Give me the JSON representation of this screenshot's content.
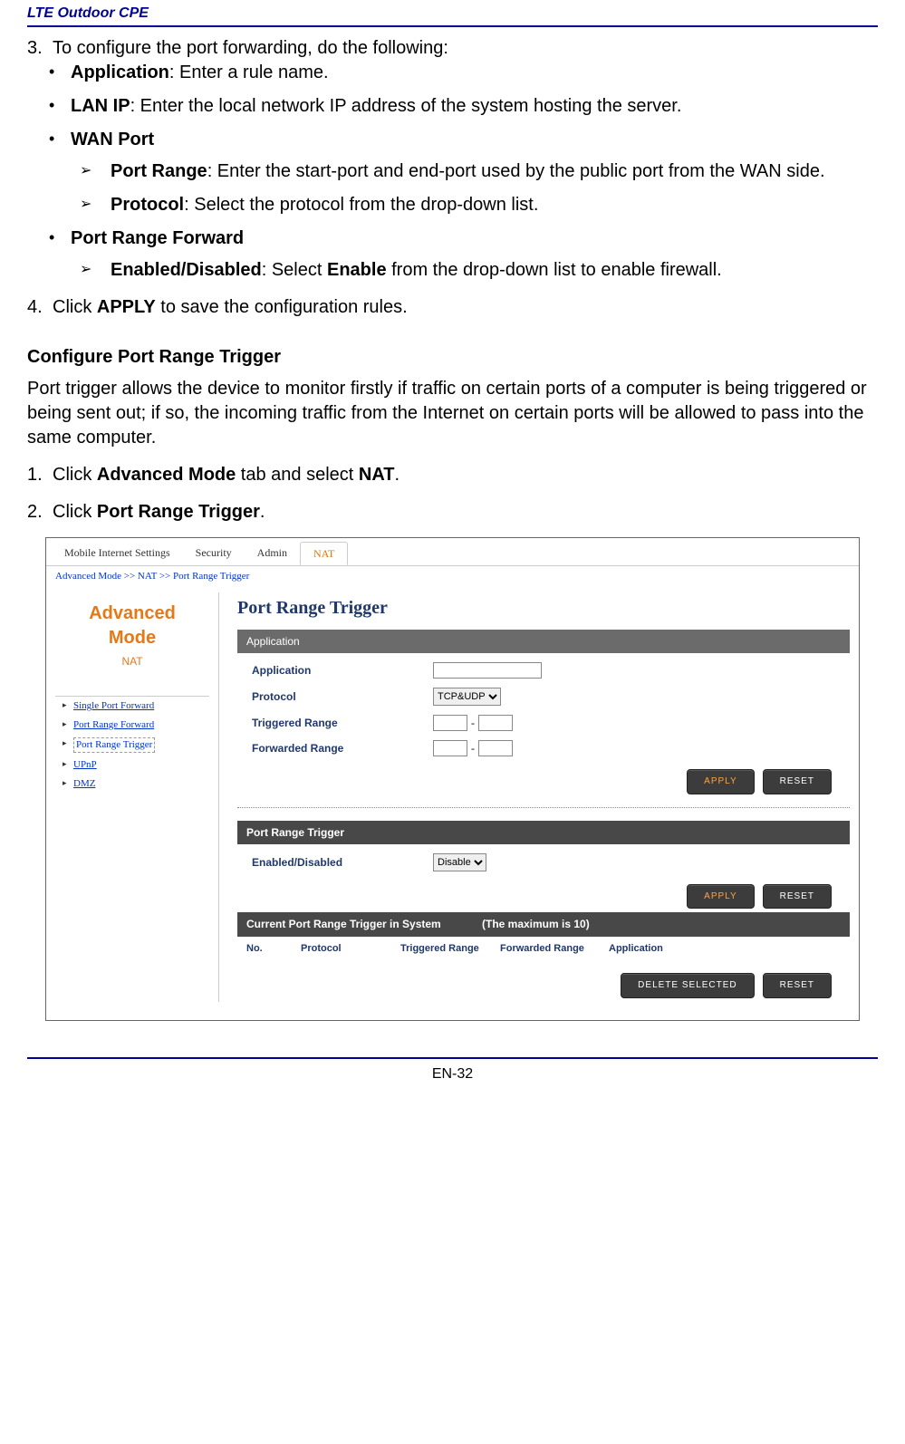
{
  "doc": {
    "header": "LTE Outdoor CPE",
    "page_num": "EN-32",
    "step3_intro": "To configure the port forwarding, do the following:",
    "step3_num": "3.",
    "b_app_t": "Application",
    "b_app_d": ": Enter a rule name.",
    "b_lan_t": "LAN IP",
    "b_lan_d": ": Enter the local network IP address of the system hosting the server.",
    "b_wan_t": "WAN Port",
    "b_pr_t": "Port Range",
    "b_pr_d": ": Enter the start-port and end-port used by the public port from the WAN side.",
    "b_proto_t": "Protocol",
    "b_proto_d": ": Select the protocol from the drop-down list.",
    "b_prf_t": "Port Range Forward",
    "b_ed_t": "Enabled/Disabled",
    "b_ed_d1": ": Select ",
    "b_ed_d2": "Enable",
    "b_ed_d3": " from the drop-down list to enable firewall.",
    "step4_num": "4.",
    "step4_a": "Click ",
    "step4_b": "APPLY",
    "step4_c": " to save the configuration rules.",
    "sect_title": "Configure Port Range Trigger",
    "sect_para": "Port trigger allows the device to monitor firstly if traffic on certain ports of a computer is being triggered or being sent out; if so, the incoming traffic from the Internet on certain ports will be allowed to pass into the same computer.",
    "s1n": "1.",
    "s1a": "Click ",
    "s1b": "Advanced Mode",
    "s1c": " tab and select ",
    "s1d": "NAT",
    "s1e": ".",
    "s2n": "2.",
    "s2a": "Click ",
    "s2b": "Port Range Trigger",
    "s2c": "."
  },
  "ui": {
    "tabs": {
      "mis": "Mobile Internet Settings",
      "sec": "Security",
      "adm": "Admin",
      "nat": "NAT"
    },
    "breadcrumb": "Advanced Mode >> NAT >> Port Range Trigger",
    "side": {
      "l1": "Advanced",
      "l2": "Mode",
      "l3": "NAT",
      "links": {
        "spf": "Single Port Forward",
        "prf": "Port Range Forward",
        "prt": "Port Range Trigger",
        "upnp": "UPnP",
        "dmz": "DMZ"
      }
    },
    "panel": {
      "title": "Port Range Trigger",
      "app_bar": "Application",
      "lbl_app": "Application",
      "lbl_proto": "Protocol",
      "proto_val": "TCP&UDP",
      "lbl_trig": "Triggered Range",
      "lbl_fwd": "Forwarded Range",
      "range_sep": "-",
      "prt_bar": "Port Range Trigger",
      "lbl_ed": "Enabled/Disabled",
      "ed_val": "Disable",
      "cur_bar_a": "Current Port Range Trigger in System",
      "cur_bar_b": "(The maximum is 10)",
      "cols": {
        "no": "No.",
        "proto": "Protocol",
        "tr": "Triggered Range",
        "fr": "Forwarded Range",
        "app": "Application"
      },
      "btn": {
        "apply": "APPLY",
        "reset": "RESET",
        "delsel": "DELETE SELECTED"
      }
    }
  }
}
